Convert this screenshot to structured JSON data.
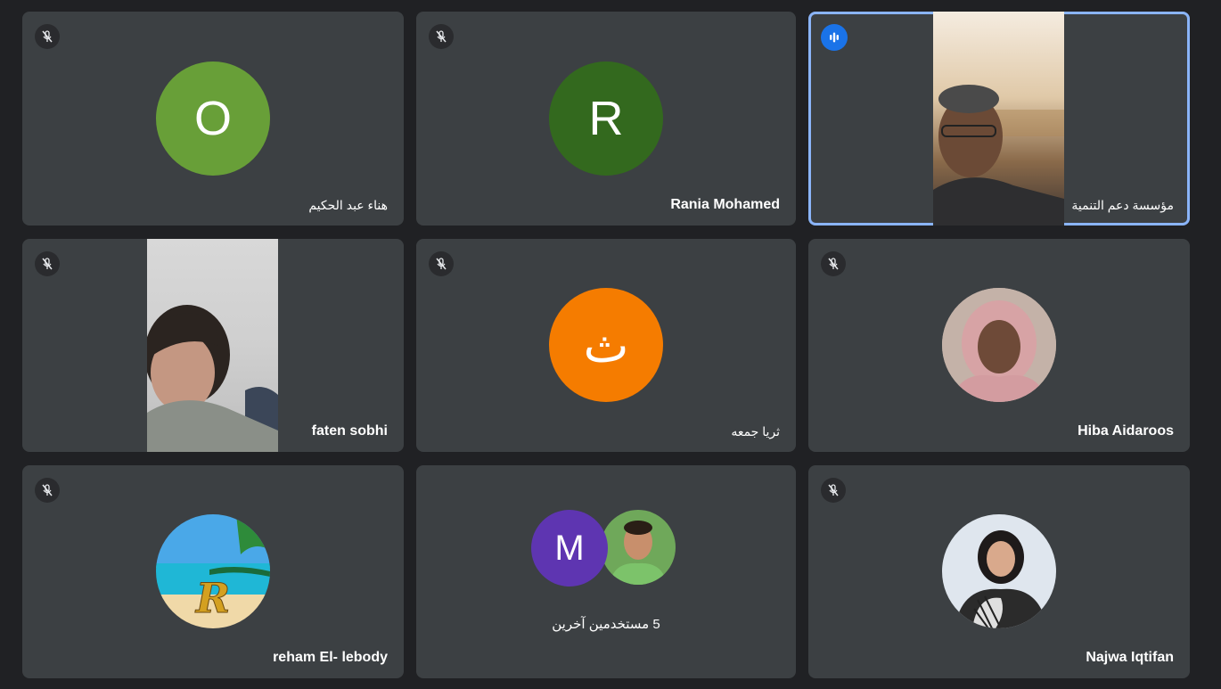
{
  "participants": [
    {
      "name": "هناء عبد الحكيم",
      "avatar_letter": "O",
      "avatar_color": "#689f38",
      "muted": true
    },
    {
      "name": "Rania Mohamed",
      "avatar_letter": "R",
      "avatar_color": "#33691e",
      "muted": true
    },
    {
      "name": "مؤسسة دعم التنمية",
      "video": true,
      "speaking": true,
      "muted": false
    },
    {
      "name": "faten sobhi",
      "video": true,
      "muted": true
    },
    {
      "name": "ثريا جمعه",
      "avatar_letter": "ث",
      "avatar_color": "#f57c00",
      "muted": true
    },
    {
      "name": "Hiba Aidaroos",
      "photo_avatar": true,
      "muted": true
    },
    {
      "name": "reham El- lebody",
      "photo_avatar": true,
      "muted": true
    },
    {
      "name": "Najwa Iqtifan",
      "photo_avatar": true,
      "muted": true
    }
  ],
  "group_tile": {
    "label": "5 مستخدمين آخرين",
    "avatar_letter": "M",
    "avatar_color": "#5e35b1"
  },
  "colors": {
    "background": "#202124",
    "tile": "#3c4043",
    "active_speaker_border": "#8ab4f8",
    "speaking_indicator": "#1a73e8"
  },
  "icons": {
    "muted": "mic-off-icon",
    "speaking": "audio-level-icon"
  }
}
